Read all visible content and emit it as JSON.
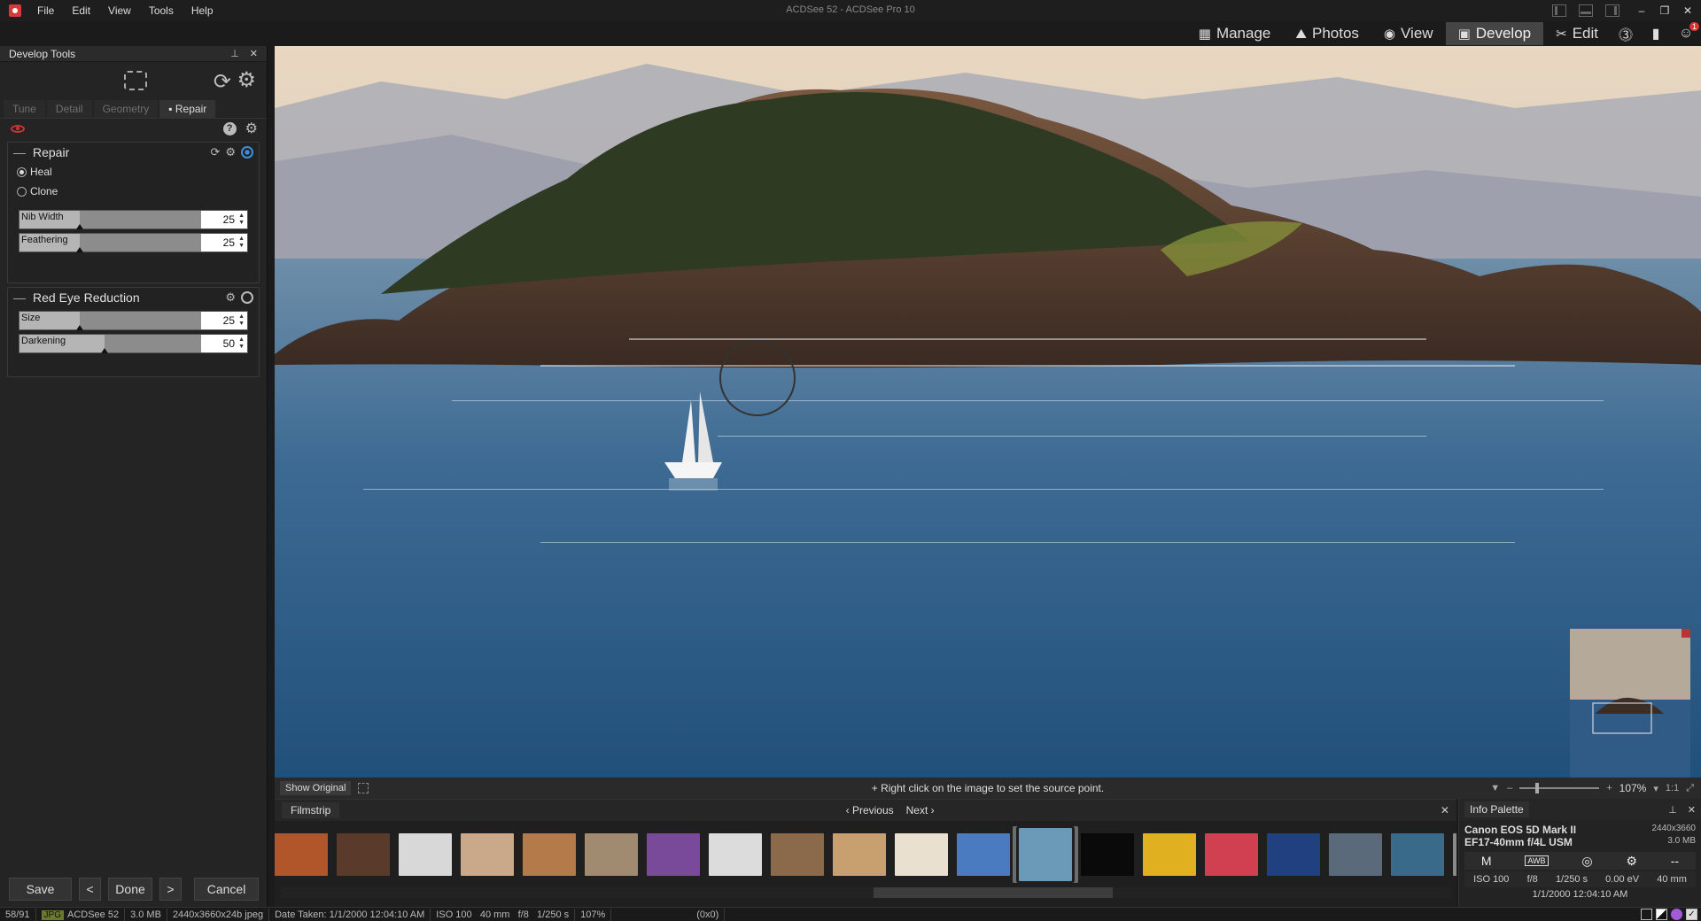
{
  "window": {
    "title": "ACDSee 52 - ACDSee Pro 10"
  },
  "menu": [
    "File",
    "Edit",
    "View",
    "Tools",
    "Help"
  ],
  "modes": [
    {
      "label": "Manage",
      "icon": "grid-icon",
      "active": false
    },
    {
      "label": "Photos",
      "icon": "photos-icon",
      "active": false
    },
    {
      "label": "View",
      "icon": "eye-icon",
      "active": false
    },
    {
      "label": "Develop",
      "icon": "develop-icon",
      "active": true
    },
    {
      "label": "Edit",
      "icon": "edit-icon",
      "active": false
    }
  ],
  "mode_extra": {
    "notification_count": "1"
  },
  "develop_tools": {
    "title": "Develop Tools",
    "tabs": [
      {
        "label": "Tune",
        "active": false
      },
      {
        "label": "Detail",
        "active": false
      },
      {
        "label": "Geometry",
        "active": false
      },
      {
        "label": "Repair",
        "active": true
      }
    ],
    "repair": {
      "title": "Repair",
      "options": [
        {
          "label": "Heal",
          "checked": true
        },
        {
          "label": "Clone",
          "checked": false
        }
      ],
      "sliders": [
        {
          "label": "Nib Width",
          "value": "25",
          "fraction": 0.25
        },
        {
          "label": "Feathering",
          "value": "25",
          "fraction": 0.25
        }
      ]
    },
    "red_eye": {
      "title": "Red Eye Reduction",
      "sliders": [
        {
          "label": "Size",
          "value": "25",
          "fraction": 0.25
        },
        {
          "label": "Darkening",
          "value": "50",
          "fraction": 0.5
        }
      ]
    },
    "buttons": {
      "save": "Save",
      "prev": "<",
      "done": "Done",
      "next": ">",
      "cancel": "Cancel"
    }
  },
  "viewer": {
    "show_original": "Show Original",
    "hint": "Right click on the image to set the source point.",
    "zoom": "107%",
    "ratio": "1:1"
  },
  "filmstrip": {
    "title": "Filmstrip",
    "previous": "Previous",
    "next": "Next",
    "thumbs": [
      "#b0562a",
      "#5a3a2a",
      "#d8d8d8",
      "#caa88a",
      "#b57a4a",
      "#a08a70",
      "#7a4a9a",
      "#dcdcdc",
      "#8a6a4a",
      "#c8a070",
      "#eae0d0",
      "#4a7ac0",
      "#6a9ab8",
      "#0a0a0a",
      "#e0b020",
      "#d04050",
      "#204080",
      "#5a6a7a",
      "#3a6a8a",
      "#8a8a8a"
    ],
    "selected_index": 12
  },
  "info_palette": {
    "title": "Info Palette",
    "camera": "Canon EOS 5D Mark II",
    "lens": "EF17-40mm f/4L USM",
    "dimensions": "2440x3660",
    "size": "3.0 MB",
    "icons": [
      "M",
      "AWB",
      "◎",
      "⚙"
    ],
    "iso": "ISO 100",
    "aperture": "f/8",
    "shutter": "1/250 s",
    "ev": "0.00 eV",
    "focal": "40 mm",
    "date": "1/1/2000 12:04:10 AM"
  },
  "status": {
    "index": "58/91",
    "format": "JPG",
    "name": "ACDSee 52",
    "size": "3.0 MB",
    "dims": "2440x3660x24b jpeg",
    "date": "Date Taken: 1/1/2000 12:04:10 AM",
    "iso": "ISO 100",
    "focal": "40 mm",
    "aperture": "f/8",
    "shutter": "1/250 s",
    "zoom": "107%",
    "coords": "(0x0)"
  }
}
